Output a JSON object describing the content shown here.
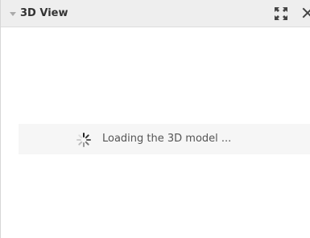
{
  "panel": {
    "title": "3D View",
    "icons": {
      "collapse": "triangle-down-icon",
      "expand": "fullscreen-expand-icon",
      "close": "close-icon"
    }
  },
  "loading": {
    "message": "Loading the 3D model ...",
    "icon": "spinner-icon"
  },
  "colors": {
    "header_bg": "#eeeeee",
    "text": "#333333",
    "loading_bg": "#f6f6f6"
  }
}
